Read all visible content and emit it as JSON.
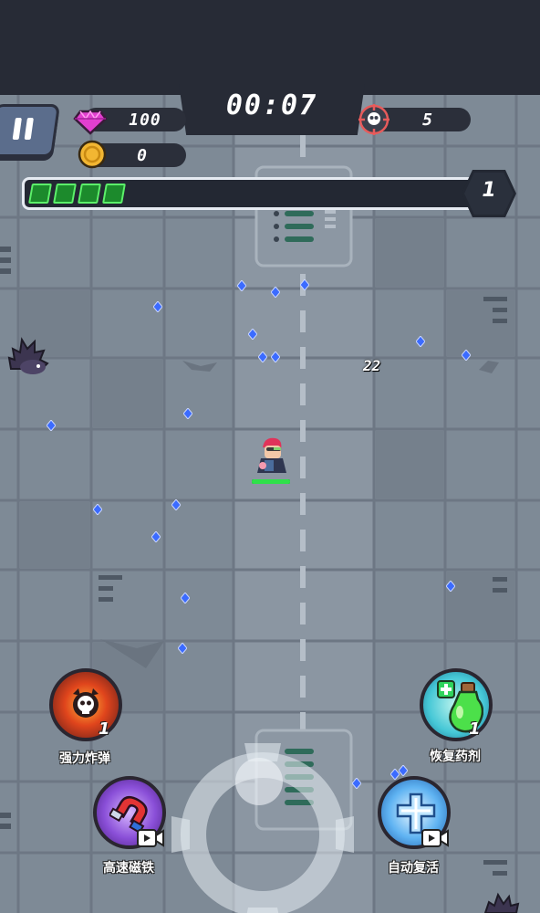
{
  "hud": {
    "timer": "00:07",
    "gems": "100",
    "coins": "0",
    "kills": "5",
    "level": "1",
    "xp_fraction": 0.27
  },
  "damage_popup": "22",
  "skills": [
    {
      "id": "bomb",
      "label": "强力炸弹",
      "count": "1",
      "icon": "skull-bomb-icon"
    },
    {
      "id": "potion",
      "label": "恢复药剂",
      "count": "1",
      "icon": "green-potion-icon"
    },
    {
      "id": "magnet",
      "label": "高速磁铁",
      "icon": "magnet-icon",
      "badge": "video-ad-icon"
    },
    {
      "id": "revive",
      "label": "自动复活",
      "icon": "revive-cross-icon",
      "badge": "video-ad-icon"
    }
  ],
  "colors": {
    "floor": "#7e8a96",
    "tile": "#8c97a3",
    "hud_dark": "#272b36",
    "xp_green": "#1c8a2c",
    "gem_pink": "#e23fcf",
    "crystal_blue": "#3b6bff"
  }
}
